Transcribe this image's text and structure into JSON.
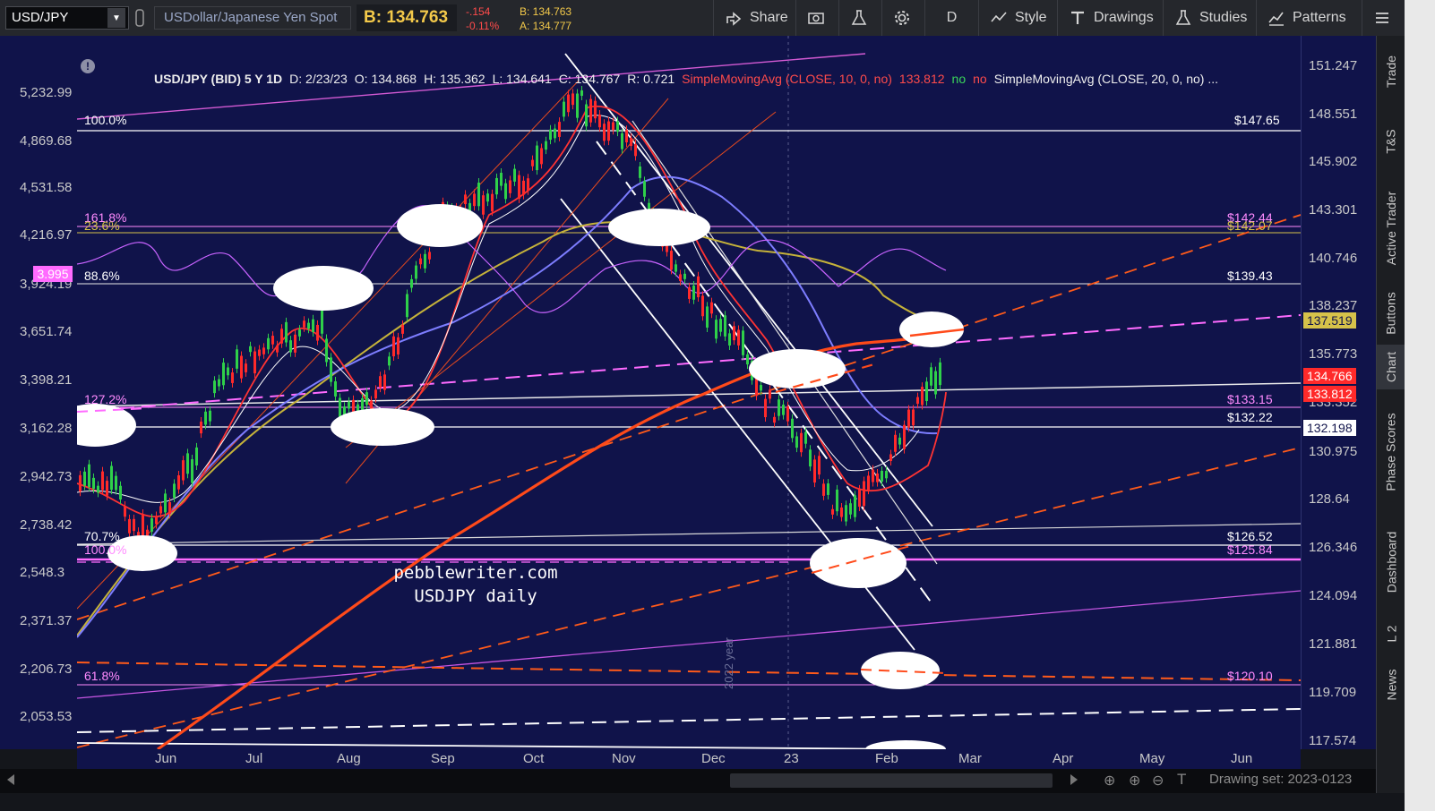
{
  "toolbar": {
    "symbol": "USD/JPY",
    "description": "USDollar/Japanese Yen Spot",
    "bid_price": "B: 134.763",
    "change": "-.154",
    "change_pct": "-0.11%",
    "bid_small": "B: 134.763",
    "ask_small": "A: 134.777",
    "share_label": "Share",
    "timeframe_label": "D",
    "style_label": "Style",
    "drawings_label": "Drawings",
    "studies_label": "Studies",
    "patterns_label": "Patterns"
  },
  "header": {
    "symbol_info": "USD/JPY (BID) 5 Y 1D",
    "date": "D: 2/23/23",
    "open": "O: 134.868",
    "high": "H: 135.362",
    "low": "L: 134.641",
    "close": "C: 134.767",
    "range": "R: 0.721",
    "sma10": "SimpleMovingAvg (CLOSE, 10, 0, no)",
    "sma10_value": "133.812",
    "no1": "no",
    "no2": "no",
    "sma20": "SimpleMovingAvg (CLOSE, 20, 0, no) ..."
  },
  "left_axis": [
    "5,232.99",
    "4,869.68",
    "4,531.58",
    "4,216.97",
    "3,924.19",
    "3,651.74",
    "3,398.21",
    "3,162.28",
    "2,942.73",
    "2,738.42",
    "2,548.3",
    "2,371.37",
    "2,206.73",
    "2,053.53"
  ],
  "right_axis": [
    "151.247",
    "148.551",
    "145.902",
    "143.301",
    "140.746",
    "138.237",
    "135.773",
    "133.352",
    "130.975",
    "128.64",
    "126.346",
    "124.094",
    "121.881",
    "119.709",
    "117.574"
  ],
  "months": [
    "Jun",
    "Jul",
    "Aug",
    "Sep",
    "Oct",
    "Nov",
    "Dec",
    "23",
    "Feb",
    "Mar",
    "Apr",
    "May",
    "Jun"
  ],
  "fib_labels": {
    "f100": "100.0%",
    "f1618": "161.8%",
    "f236": "23.6%",
    "f886": "88.6%",
    "f1272": "127.2%",
    "f707": "70.7%",
    "f100b": "100.0%",
    "f618": "61.8%",
    "flo": "61.8%"
  },
  "level_labels": {
    "p14765": "$147.65",
    "p14244": "$142.44",
    "p14207": "$142.07",
    "p13943": "$139.43",
    "p13315": "$133.15",
    "p13222": "$132.22",
    "p12652": "$126.52",
    "p12584": "$125.84",
    "p12010": "$120.10"
  },
  "price_tags": {
    "t1": "137.519",
    "t2": "134.766",
    "t3": "133.812",
    "t4": "132.198"
  },
  "indicator_badge": "3.995",
  "watermark": {
    "line1": "pebblewriter.com",
    "line2": "USDJPY daily"
  },
  "year_label": "2022 year",
  "drawing_set": "Drawing set: 2023-0123",
  "sidebar_tabs": [
    "Trade",
    "T&S",
    "Active Trader",
    "Buttons",
    "Chart",
    "Phase Scores",
    "Dashboard",
    "L 2",
    "News"
  ],
  "colors": {
    "chart_bg": "#10134a",
    "sma10": "#ff2a2a",
    "sma200": "#ff4a00",
    "fib_magenta": "#ff7bff",
    "accent_gold": "#f3c94a"
  }
}
